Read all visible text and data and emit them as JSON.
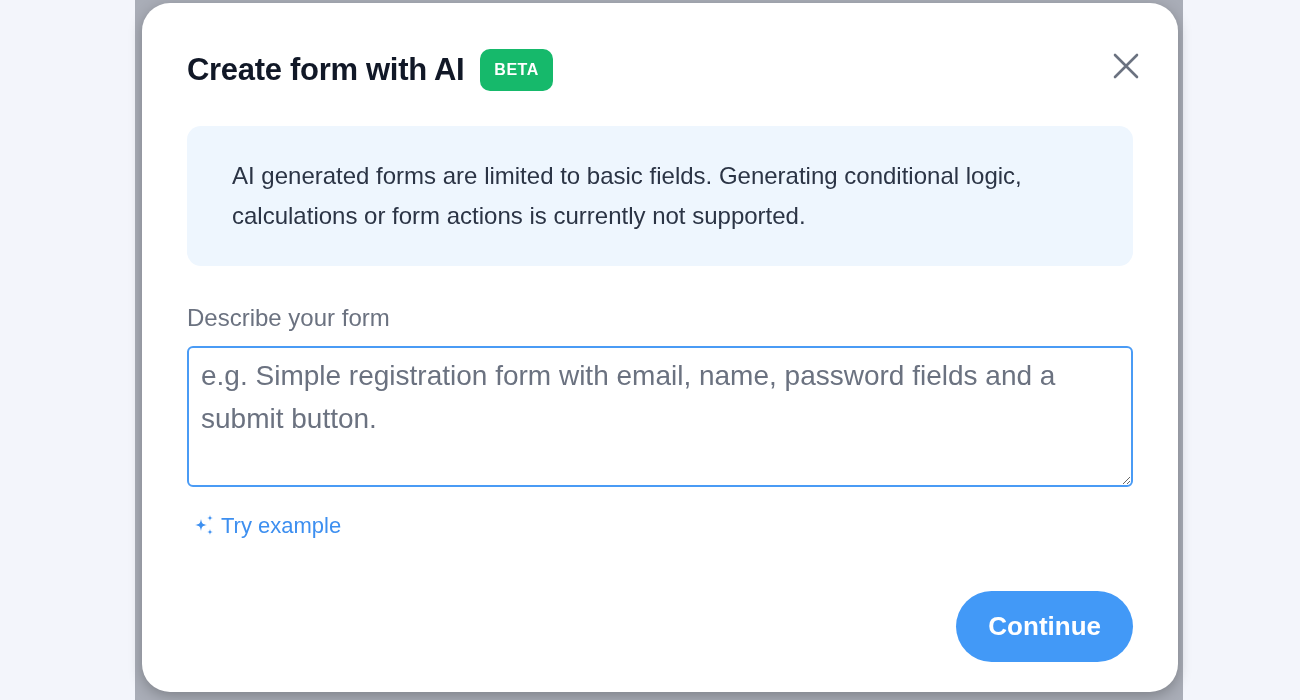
{
  "dialog": {
    "title": "Create form with AI",
    "badge": "BETA",
    "notice": "AI generated forms are limited to basic fields. Generating conditional logic, calculations or form actions is currently not supported.",
    "field": {
      "label": "Describe your form",
      "placeholder": "e.g. Simple registration form with email, name, password fields and a submit button."
    },
    "link": "Try example",
    "buttons": [
      "Continue"
    ]
  }
}
